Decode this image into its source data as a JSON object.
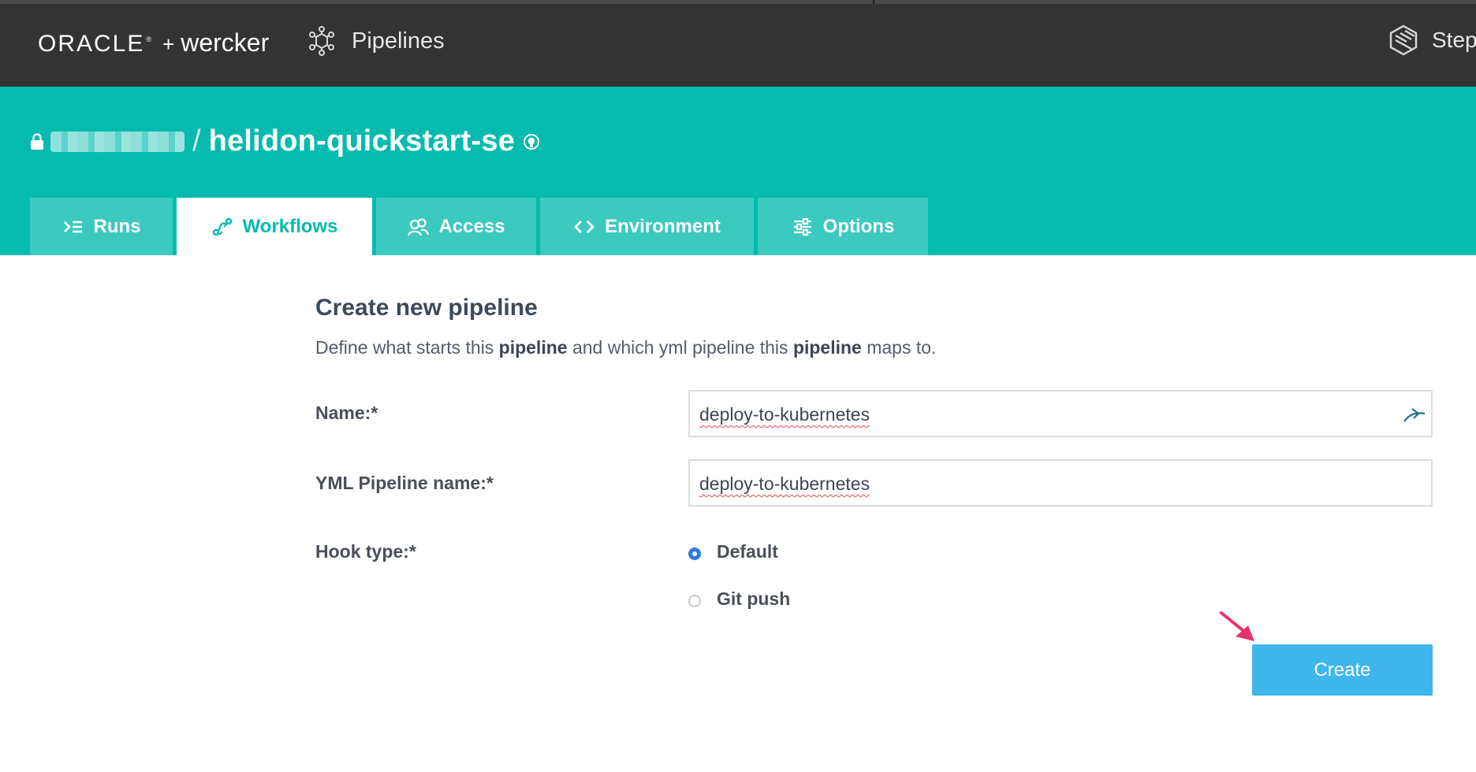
{
  "topbar": {
    "brand_oracle": "ORACLE",
    "brand_tm": "®",
    "brand_plus": "+",
    "brand_wercker": "wercker",
    "nav_pipelines": "Pipelines",
    "nav_steps": "Steps"
  },
  "header": {
    "slash": "/",
    "repo_name": "helidon-quickstart-se",
    "tabs": [
      {
        "label": "Runs",
        "icon": "runs-icon"
      },
      {
        "label": "Workflows",
        "icon": "workflows-icon",
        "active": true
      },
      {
        "label": "Access",
        "icon": "access-icon"
      },
      {
        "label": "Environment",
        "icon": "code-icon"
      },
      {
        "label": "Options",
        "icon": "options-icon"
      }
    ]
  },
  "form": {
    "title": "Create new pipeline",
    "desc": {
      "p1": "Define what starts this ",
      "b1": "pipeline",
      "p2": " and which yml pipeline this ",
      "b2": "pipeline",
      "p3": " maps to."
    },
    "name_label": "Name:*",
    "name_value": "deploy-to-kubernetes",
    "yml_label": "YML Pipeline name:*",
    "yml_value": "deploy-to-kubernetes",
    "hook_label": "Hook type:*",
    "hook_options": [
      {
        "label": "Default",
        "selected": true
      },
      {
        "label": "Git push",
        "selected": false
      }
    ],
    "create_label": "Create"
  },
  "colors": {
    "topbar": "#333333",
    "teal": "#04bbae",
    "tab": "#3cc9bf",
    "button": "#3fb6ec",
    "radio": "#2d7ae8",
    "arrow": "#e8316f"
  }
}
